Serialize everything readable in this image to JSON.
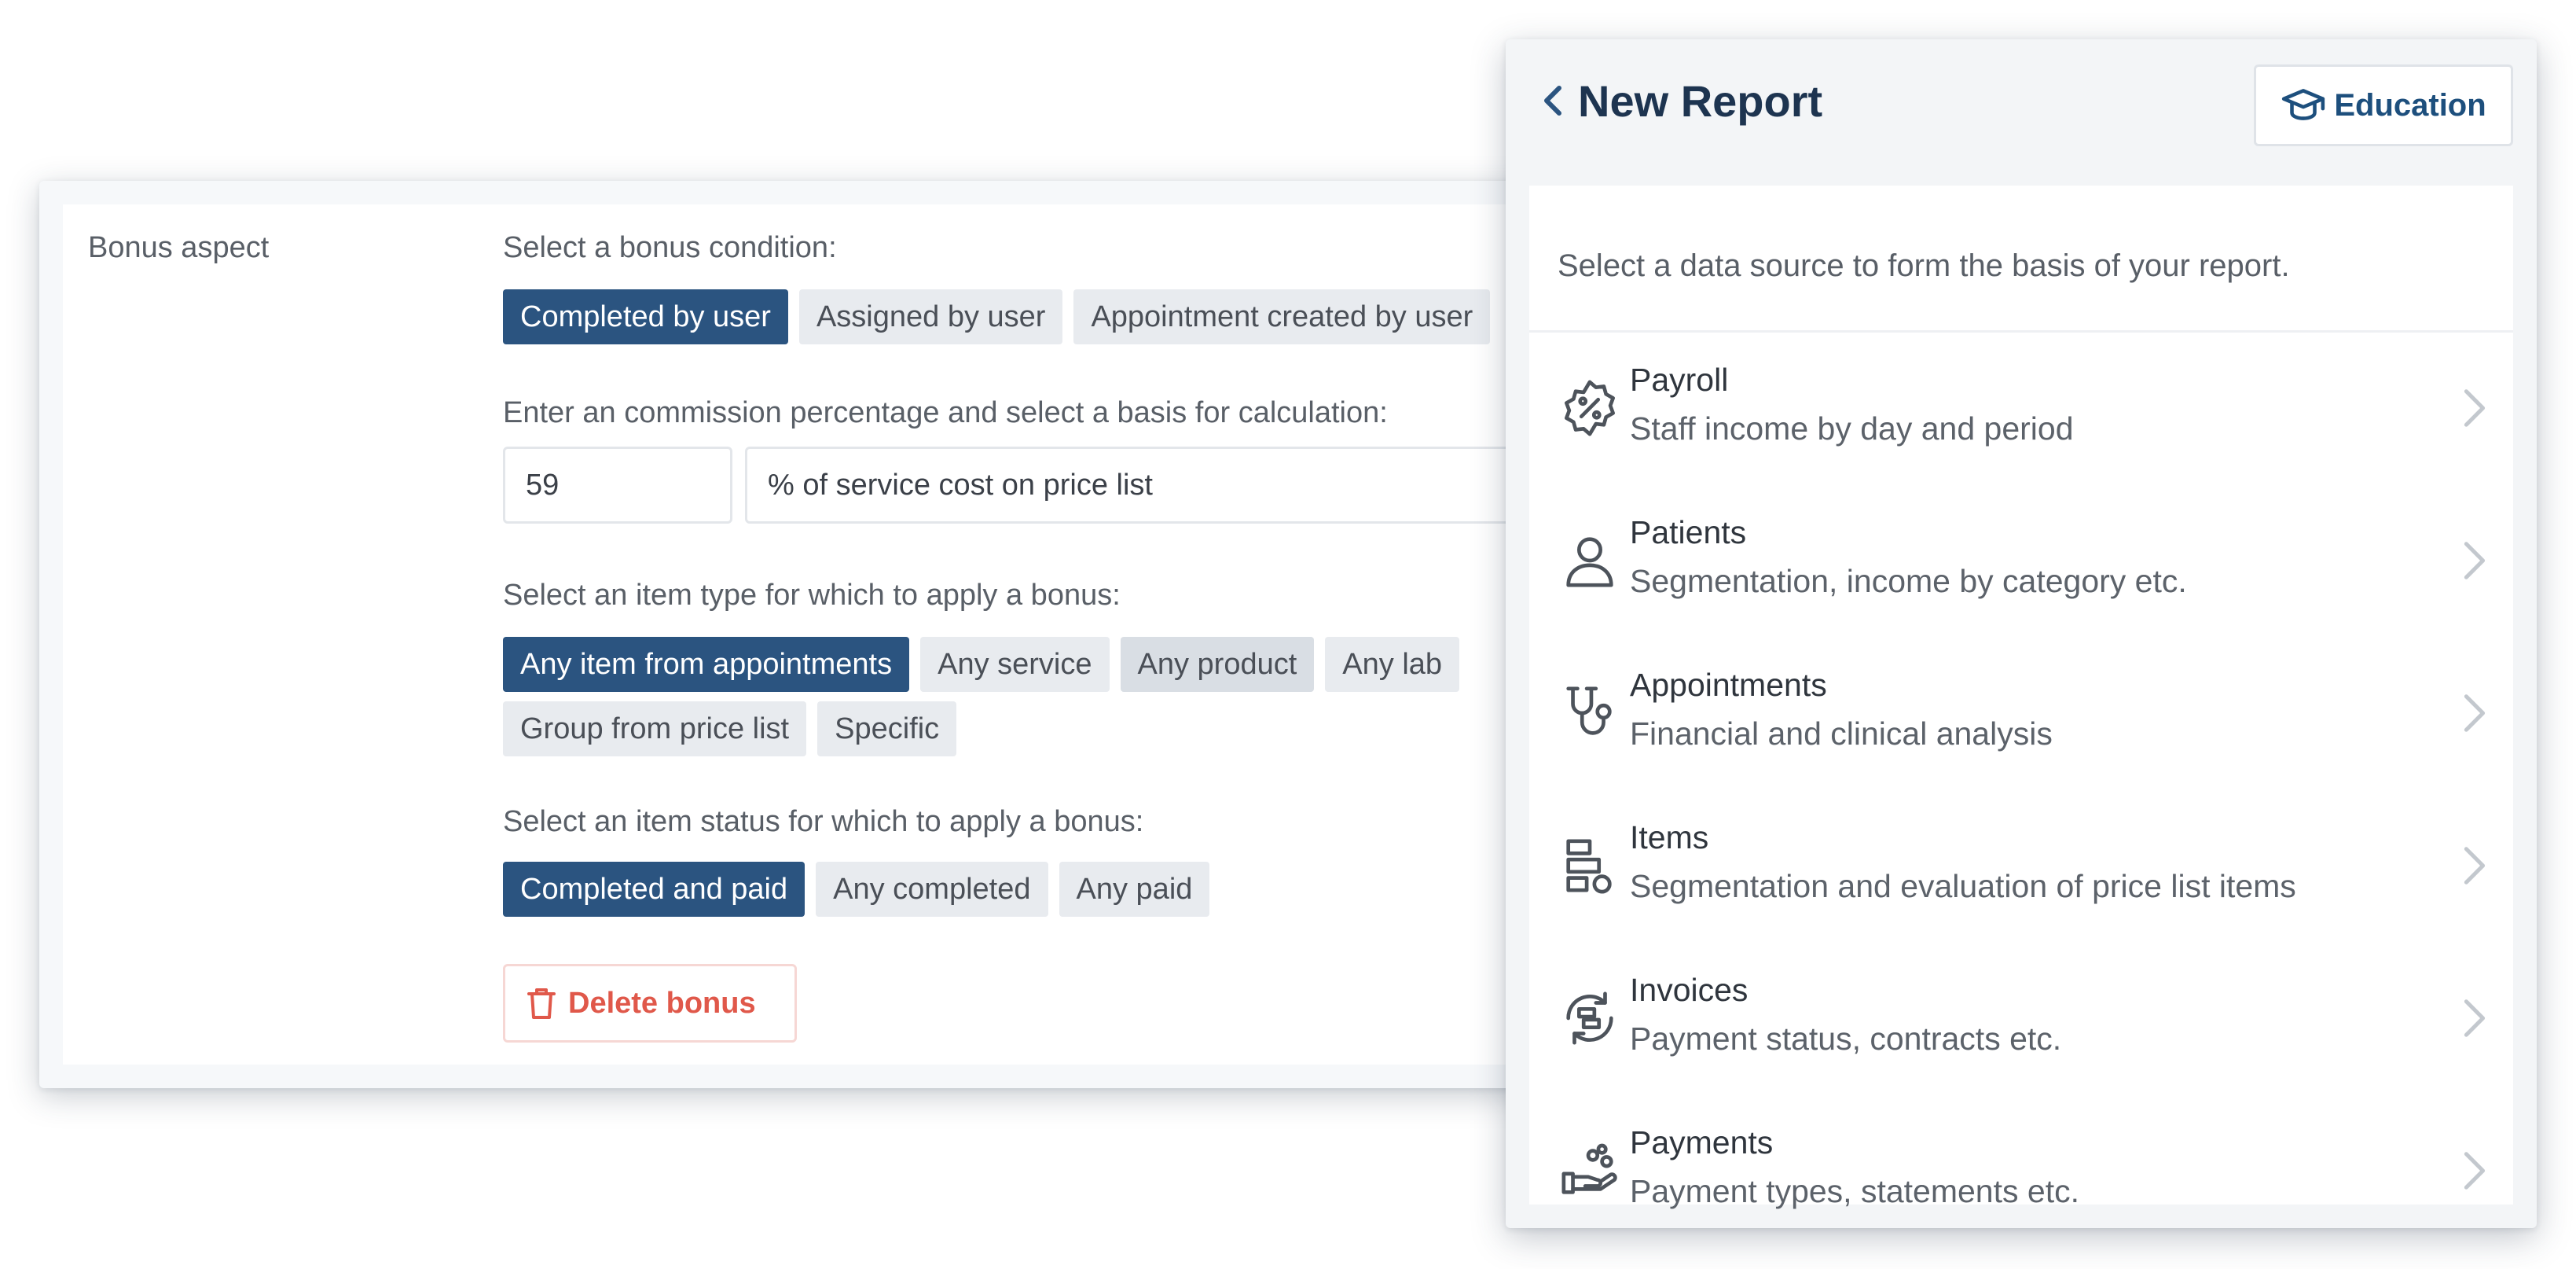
{
  "bonus": {
    "aspect_label": "Bonus aspect",
    "condition_prompt": "Select a bonus condition:",
    "condition_chips": [
      {
        "label": "Completed by user",
        "active": true
      },
      {
        "label": "Assigned by user",
        "active": false
      },
      {
        "label": "Appointment created by user",
        "active": false
      }
    ],
    "commission_prompt": "Enter an commission percentage and select a basis for calculation:",
    "commission_value": "59",
    "basis_value": "% of service cost on price list",
    "item_type_prompt": "Select an item type for which to apply a bonus:",
    "item_type_chips_row1": [
      {
        "label": "Any item from appointments",
        "active": true
      },
      {
        "label": "Any service",
        "active": false
      },
      {
        "label": "Any product",
        "active": false
      },
      {
        "label": "Any lab",
        "active": false
      }
    ],
    "item_type_chips_row2": [
      {
        "label": "Group from price list",
        "active": false
      },
      {
        "label": "Specific",
        "active": false
      }
    ],
    "status_prompt": "Select an item status for which to apply a bonus:",
    "status_chips": [
      {
        "label": "Completed and paid",
        "active": true
      },
      {
        "label": "Any completed",
        "active": false
      },
      {
        "label": "Any paid",
        "active": false
      }
    ],
    "delete_label": "Delete bonus"
  },
  "report": {
    "title": "New Report",
    "education_label": "Education",
    "subtitle": "Select a data source to form the basis of your report.",
    "sources": [
      {
        "title": "Payroll",
        "desc": "Staff income by day and period",
        "icon": "percent-badge-icon"
      },
      {
        "title": "Patients",
        "desc": "Segmentation, income by category etc.",
        "icon": "user-icon"
      },
      {
        "title": "Appointments",
        "desc": "Financial and clinical analysis",
        "icon": "stethoscope-icon"
      },
      {
        "title": "Items",
        "desc": "Segmentation and evaluation of price list items",
        "icon": "items-stack-icon"
      },
      {
        "title": "Invoices",
        "desc": "Payment status, contracts etc.",
        "icon": "invoice-cycle-icon"
      },
      {
        "title": "Payments",
        "desc": "Payment types, statements etc.",
        "icon": "hand-coins-icon"
      }
    ]
  },
  "colors": {
    "active_chip": "#2b5480",
    "chip": "#e8ebef",
    "title": "#1d3450",
    "delete": "#e0584a"
  }
}
